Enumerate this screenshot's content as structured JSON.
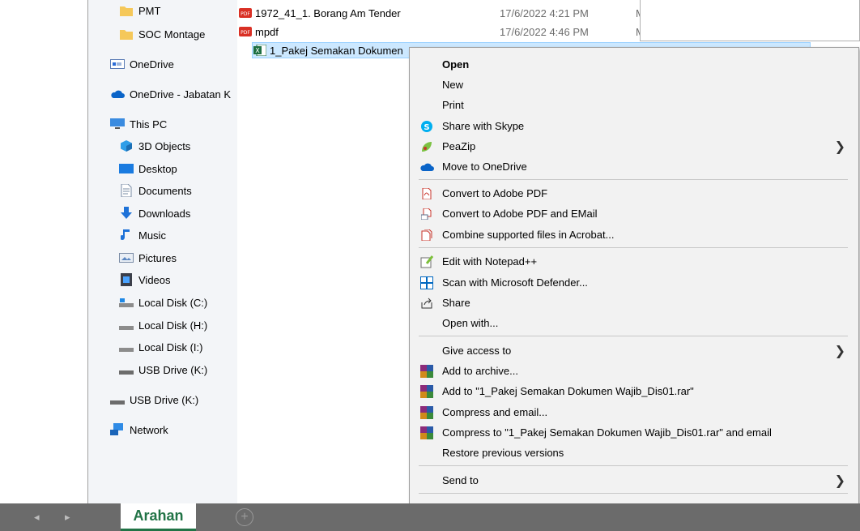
{
  "nav": {
    "items": [
      {
        "label": "PMT",
        "icon": "folder-icon"
      },
      {
        "label": "SOC Montage",
        "icon": "folder-icon"
      },
      {
        "label": "OneDrive",
        "icon": "onedrive-icon"
      },
      {
        "label": "OneDrive - Jabatan K",
        "icon": "cloud-icon"
      },
      {
        "label": "This PC",
        "icon": "computer-icon"
      },
      {
        "label": "3D Objects",
        "icon": "cube-icon"
      },
      {
        "label": "Desktop",
        "icon": "desktop-icon"
      },
      {
        "label": "Documents",
        "icon": "document-icon"
      },
      {
        "label": "Downloads",
        "icon": "download-icon"
      },
      {
        "label": "Music",
        "icon": "music-icon"
      },
      {
        "label": "Pictures",
        "icon": "pictures-icon"
      },
      {
        "label": "Videos",
        "icon": "video-icon"
      },
      {
        "label": "Local Disk (C:)",
        "icon": "drive-icon"
      },
      {
        "label": "Local Disk (H:)",
        "icon": "drive-icon"
      },
      {
        "label": "Local Disk (I:)",
        "icon": "drive-icon"
      },
      {
        "label": "USB Drive (K:)",
        "icon": "usb-drive-icon"
      },
      {
        "label": "USB Drive (K:)",
        "icon": "usb-drive-icon"
      },
      {
        "label": "Network",
        "icon": "network-icon"
      }
    ]
  },
  "files": [
    {
      "name": "1972_41_1. Borang Am Tender",
      "date": "17/6/2022 4:21 PM",
      "type": "M",
      "icon": "pdf-icon"
    },
    {
      "name": "mpdf",
      "date": "17/6/2022 4:46 PM",
      "type": "M",
      "icon": "pdf-icon"
    },
    {
      "name": "1_Pakej Semakan Dokumen",
      "icon": "excel-icon"
    }
  ],
  "context_menu": {
    "open": "Open",
    "new": "New",
    "print": "Print",
    "skype": "Share with Skype",
    "peazip": "PeaZip",
    "onedrive": "Move to OneDrive",
    "adobe_pdf": "Convert to Adobe PDF",
    "adobe_email": "Convert to Adobe PDF and EMail",
    "acrobat_combine": "Combine supported files in Acrobat...",
    "notepad": "Edit with Notepad++",
    "defender": "Scan with Microsoft Defender...",
    "share": "Share",
    "open_with": "Open with...",
    "give_access": "Give access to",
    "add_archive": "Add to archive...",
    "add_rar": "Add to \"1_Pakej Semakan Dokumen Wajib_Dis01.rar\"",
    "compress_email": "Compress and email...",
    "compress_rar_email": "Compress to \"1_Pakej Semakan Dokumen Wajib_Dis01.rar\" and email",
    "restore": "Restore previous versions",
    "send_to": "Send to"
  },
  "sheet_tab": {
    "label": "Arahan"
  },
  "colors": {
    "accent": "#217346",
    "selection": "#cce8ff",
    "menu_bg": "#f2f2f2"
  }
}
